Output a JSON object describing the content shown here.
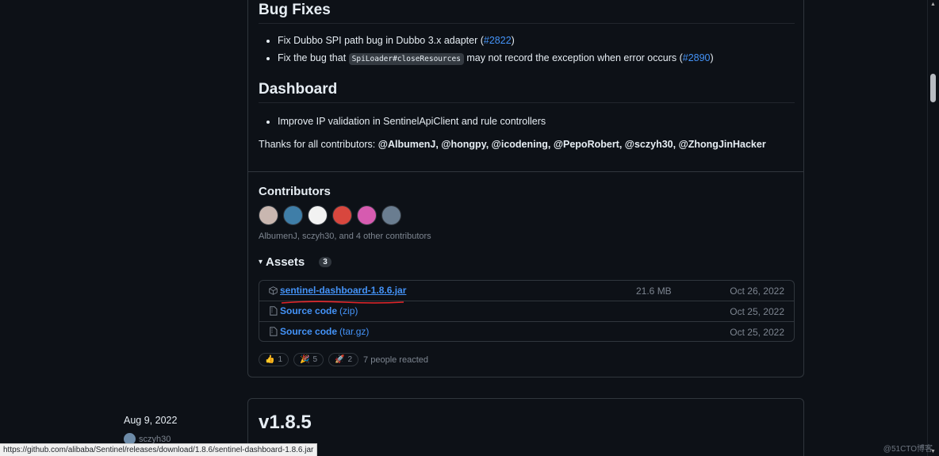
{
  "bug_fixes": {
    "heading": "Bug Fixes",
    "items": [
      {
        "text": "Fix Dubbo SPI path bug in Dubbo 3.x adapter (",
        "link": "#2822",
        "tail": ")"
      },
      {
        "prefix": "Fix the bug that ",
        "code": "SpiLoader#closeResources",
        "text": " may not record the exception when error occurs (",
        "link": "#2890",
        "tail": ")"
      }
    ]
  },
  "dashboard": {
    "heading": "Dashboard",
    "items": [
      "Improve IP validation in SentinelApiClient and rule controllers"
    ]
  },
  "thanks": {
    "prefix": "Thanks for all contributors: ",
    "names": "@AlbumenJ, @hongpy, @icodening, @PepoRobert, @sczyh30, @ZhongJinHacker"
  },
  "contributors": {
    "heading": "Contributors",
    "note": "AlbumenJ, sczyh30, and 4 other contributors",
    "avatar_colors": [
      "#c9b7b0",
      "#3f7ea8",
      "#f2f2f2",
      "#d8473e",
      "#d65bb0",
      "#6a7d90"
    ]
  },
  "assets": {
    "heading": "Assets",
    "count": "3",
    "rows": [
      {
        "name": "sentinel-dashboard-1.8.6.jar",
        "sub": "",
        "size": "21.6 MB",
        "date": "Oct 26, 2022",
        "icon": "package-icon"
      },
      {
        "name": "Source code",
        "sub": " (zip)",
        "size": "",
        "date": "Oct 25, 2022",
        "icon": "file-zip-icon"
      },
      {
        "name": "Source code",
        "sub": " (tar.gz)",
        "size": "",
        "date": "Oct 25, 2022",
        "icon": "file-zip-icon"
      }
    ]
  },
  "reactions": {
    "items": [
      {
        "emoji": "👍",
        "count": "1"
      },
      {
        "emoji": "🎉",
        "count": "5"
      },
      {
        "emoji": "🚀",
        "count": "2"
      }
    ],
    "summary": "7 people reacted"
  },
  "next_release": {
    "date": "Aug 9, 2022",
    "author": "sczyh30",
    "title": "v1.8.5"
  },
  "statusbar": {
    "url": "https://github.com/alibaba/Sentinel/releases/download/1.8.6/sentinel-dashboard-1.8.6.jar"
  },
  "watermark": "@51CTO博客",
  "colors": {
    "link": "#4493f8",
    "background": "#0d1117",
    "annotation_line": "#e5262a"
  }
}
